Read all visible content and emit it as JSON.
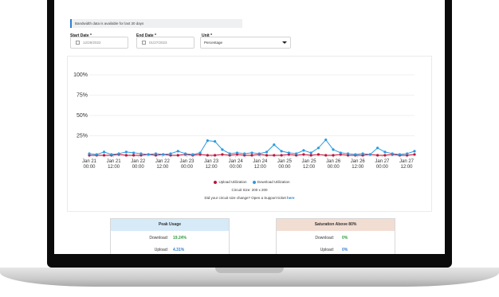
{
  "notice": "Bandwidth data is available for last 30 days",
  "filters": {
    "start_label": "Start Date *",
    "start_value": "12/29/2022",
    "end_label": "End Date *",
    "end_value": "01/27/2023",
    "unit_label": "Unit *",
    "unit_value": "Percentage"
  },
  "chart_data": {
    "type": "line",
    "yticks": [
      "100%",
      "75%",
      "50%",
      "25%"
    ],
    "ylim": [
      0,
      100
    ],
    "x": [
      "Jan 21 00:00",
      "Jan 21 12:00",
      "Jan 22 00:00",
      "Jan 22 12:00",
      "Jan 23 00:00",
      "Jan 23 12:00",
      "Jan 24 00:00",
      "Jan 24 12:00",
      "Jan 25 00:00",
      "Jan 25 12:00",
      "Jan 26 00:00",
      "Jan 26 12:00",
      "Jan 27 00:00",
      "Jan 27 12:00"
    ],
    "x_tick_labels": [
      [
        "Jan 21",
        "00:00"
      ],
      [
        "Jan 21",
        "12:00"
      ],
      [
        "Jan 22",
        "00:00"
      ],
      [
        "Jan 22",
        "12:00"
      ],
      [
        "Jan 23",
        "00:00"
      ],
      [
        "Jan 23",
        "12:00"
      ],
      [
        "Jan 24",
        "00:00"
      ],
      [
        "Jan 24",
        "12:00"
      ],
      [
        "Jan 25",
        "00:00"
      ],
      [
        "Jan 25",
        "12:00"
      ],
      [
        "Jan 26",
        "00:00"
      ],
      [
        "Jan 26",
        "12:00"
      ],
      [
        "Jan 27",
        "00:00"
      ],
      [
        "Jan 27",
        "12:00"
      ]
    ],
    "series": [
      {
        "name": "Upload Utilization",
        "color": "#c0143c",
        "values": [
          1,
          1,
          1,
          1,
          2,
          1,
          1,
          1,
          2,
          1,
          2,
          1,
          1,
          2,
          1,
          2,
          1,
          1,
          2,
          1,
          2,
          1,
          1,
          2,
          1,
          1,
          1,
          2,
          1,
          2,
          1,
          2,
          1,
          1,
          2,
          1,
          1,
          1,
          2,
          1,
          1,
          2,
          1,
          1,
          2
        ]
      },
      {
        "name": "Download Utilization",
        "color": "#2b9be0",
        "values": [
          3,
          2,
          5,
          2,
          3,
          5,
          4,
          3,
          2,
          3,
          2,
          3,
          6,
          3,
          2,
          4,
          19,
          18,
          8,
          3,
          4,
          3,
          4,
          3,
          5,
          14,
          6,
          4,
          3,
          7,
          4,
          10,
          20,
          8,
          4,
          3,
          2,
          3,
          2,
          10,
          5,
          3,
          2,
          3,
          6
        ]
      }
    ]
  },
  "legend": {
    "upload": "Upload Utilization",
    "download": "Download Utilization"
  },
  "circuit_size": "Circuit Size: 200 x 200",
  "support": {
    "text": "Did your circuit size change? Open a Support ticket here",
    "prefix": "Did your circuit size change? Open a Support ticket ",
    "link": "here"
  },
  "peak": {
    "title": "Peak Usage",
    "download_label": "Download:",
    "download_value": "19.24%",
    "upload_label": "Upload:",
    "upload_value": "4.31%"
  },
  "saturation": {
    "title": "Saturation Above 80%",
    "download_label": "Download:",
    "download_value": "0%",
    "upload_label": "Upload:",
    "upload_value": "0%"
  },
  "colors": {
    "accent": "#2f7fd1",
    "peak_header": "#d6eaf8",
    "saturation_header": "#f2ddd3",
    "value_green": "#2e9a3c",
    "value_blue": "#2f7fd1"
  }
}
